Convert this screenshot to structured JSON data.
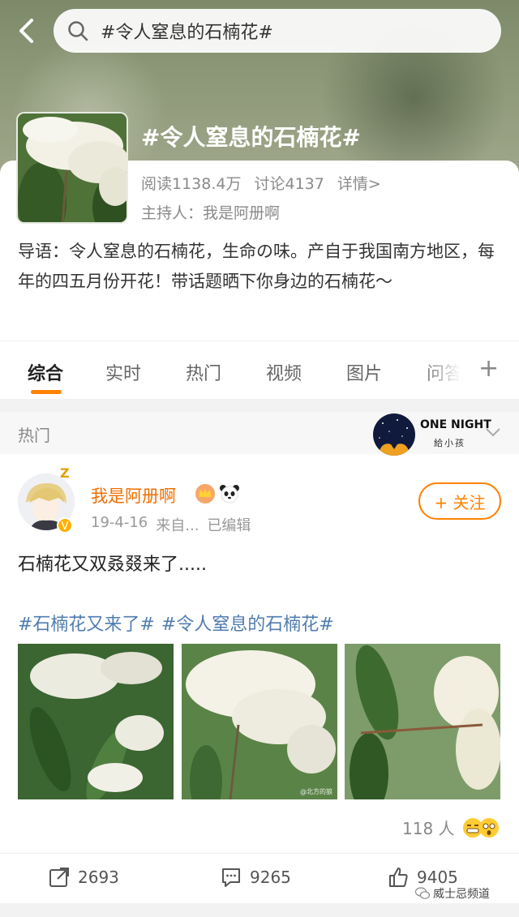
{
  "header": {
    "search_text": "#令人窒息的石楠花#"
  },
  "topic": {
    "title": "#令人窒息的石楠花#",
    "reads": "阅读1138.4万",
    "discussions": "讨论4137",
    "details_link": "详情>",
    "host": "主持人：我是阿册啊",
    "intro": "导语：令人窒息的石楠花，生命の味。产自于我国南方地区，每年的四五月份开花！带话题晒下你身边的石楠花～"
  },
  "tabs": [
    {
      "label": "综合"
    },
    {
      "label": "实时"
    },
    {
      "label": "热门"
    },
    {
      "label": "视频"
    },
    {
      "label": "图片"
    },
    {
      "label": "问答"
    }
  ],
  "tab_plus": "+",
  "section": {
    "label": "热门",
    "ad_title": "ONE NIGHT",
    "ad_subtitle": "給小孩"
  },
  "post": {
    "zzz": "Z",
    "username": "我是阿册啊",
    "date": "19-4-16",
    "source": "来自...",
    "edited": "已编辑",
    "follow_label": "+ 关注",
    "text": "石楠花又双叒叕来了.....",
    "tags": [
      "#石楠花又来了#",
      "#令人窒息的石楠花#"
    ],
    "photo_watermark": "@北方的狼",
    "reaction_count": "118 人"
  },
  "actions": {
    "reposts": "2693",
    "comments": "9265",
    "likes": "9405"
  },
  "footer": {
    "wechat_label": "威士忌频道"
  },
  "colors": {
    "accent": "#ff8200",
    "username": "#f06e00",
    "tag_link": "#507daf"
  }
}
